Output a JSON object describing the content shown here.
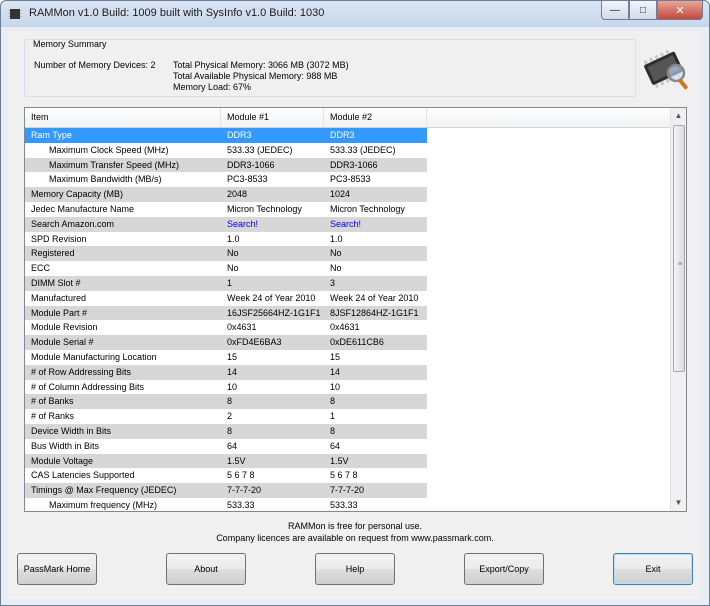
{
  "window": {
    "title": "RAMMon v1.0 Build: 1009 built with SysInfo v1.0 Build: 1030"
  },
  "summary": {
    "legend": "Memory Summary",
    "devices": "Number of Memory Devices: 2",
    "total_physical": "Total Physical Memory: 3066 MB (3072 MB)",
    "total_available": "Total Available Physical Memory: 988 MB",
    "memory_load": "Memory Load: 67%"
  },
  "table": {
    "headers": [
      "Item",
      "Module #1",
      "Module #2"
    ],
    "rows": [
      {
        "item": "Ram Type",
        "m1": "DDR3",
        "m2": "DDR3",
        "sub": false,
        "shade": false,
        "selected": true
      },
      {
        "item": "Maximum Clock Speed (MHz)",
        "m1": "533.33 (JEDEC)",
        "m2": "533.33 (JEDEC)",
        "sub": true,
        "shade": false
      },
      {
        "item": "Maximum Transfer Speed (MHz)",
        "m1": "DDR3-1066",
        "m2": "DDR3-1066",
        "sub": true,
        "shade": true
      },
      {
        "item": "Maximum Bandwidth (MB/s)",
        "m1": "PC3-8533",
        "m2": "PC3-8533",
        "sub": true,
        "shade": false
      },
      {
        "item": "Memory Capacity (MB)",
        "m1": "2048",
        "m2": "1024",
        "sub": false,
        "shade": true
      },
      {
        "item": "Jedec Manufacture Name",
        "m1": "Micron Technology",
        "m2": "Micron Technology",
        "sub": false,
        "shade": false
      },
      {
        "item": "Search Amazon.com",
        "m1": "Search!",
        "m2": "Search!",
        "sub": false,
        "shade": true,
        "link": true
      },
      {
        "item": "SPD Revision",
        "m1": "1.0",
        "m2": "1.0",
        "sub": false,
        "shade": false
      },
      {
        "item": "Registered",
        "m1": "No",
        "m2": "No",
        "sub": false,
        "shade": true
      },
      {
        "item": "ECC",
        "m1": "No",
        "m2": "No",
        "sub": false,
        "shade": false
      },
      {
        "item": "DIMM Slot #",
        "m1": "1",
        "m2": "3",
        "sub": false,
        "shade": true
      },
      {
        "item": "Manufactured",
        "m1": "Week 24 of Year 2010",
        "m2": "Week 24 of Year 2010",
        "sub": false,
        "shade": false
      },
      {
        "item": "Module Part #",
        "m1": "16JSF25664HZ-1G1F1",
        "m2": "8JSF12864HZ-1G1F1",
        "sub": false,
        "shade": true
      },
      {
        "item": "Module Revision",
        "m1": "0x4631",
        "m2": "0x4631",
        "sub": false,
        "shade": false
      },
      {
        "item": "Module Serial #",
        "m1": "0xFD4E6BA3",
        "m2": "0xDE611CB6",
        "sub": false,
        "shade": true
      },
      {
        "item": "Module Manufacturing Location",
        "m1": "15",
        "m2": "15",
        "sub": false,
        "shade": false
      },
      {
        "item": "# of Row Addressing Bits",
        "m1": "14",
        "m2": "14",
        "sub": false,
        "shade": true
      },
      {
        "item": "# of Column Addressing Bits",
        "m1": "10",
        "m2": "10",
        "sub": false,
        "shade": false
      },
      {
        "item": "# of Banks",
        "m1": "8",
        "m2": "8",
        "sub": false,
        "shade": true
      },
      {
        "item": "# of Ranks",
        "m1": "2",
        "m2": "1",
        "sub": false,
        "shade": false
      },
      {
        "item": "Device Width in Bits",
        "m1": "8",
        "m2": "8",
        "sub": false,
        "shade": true
      },
      {
        "item": "Bus Width in Bits",
        "m1": "64",
        "m2": "64",
        "sub": false,
        "shade": false
      },
      {
        "item": "Module Voltage",
        "m1": "1.5V",
        "m2": "1.5V",
        "sub": false,
        "shade": true
      },
      {
        "item": "CAS Latencies Supported",
        "m1": "5 6 7 8",
        "m2": "5 6 7 8",
        "sub": false,
        "shade": false
      },
      {
        "item": "Timings @ Max Frequency (JEDEC)",
        "m1": "7-7-7-20",
        "m2": "7-7-7-20",
        "sub": false,
        "shade": true
      },
      {
        "item": "Maximum frequency (MHz)",
        "m1": "533.33",
        "m2": "533.33",
        "sub": true,
        "shade": false
      }
    ]
  },
  "footer": {
    "line1": "RAMMon is free for personal use.",
    "line2": "Company licences are available on request from www.passmark.com."
  },
  "buttons": {
    "passmark_home": "PassMark Home",
    "about": "About",
    "help": "Help",
    "export_copy": "Export/Copy",
    "exit": "Exit"
  },
  "colors": {
    "selection": "#3399ff",
    "row_shade": "#d7d7d7",
    "link": "#0000ee"
  }
}
